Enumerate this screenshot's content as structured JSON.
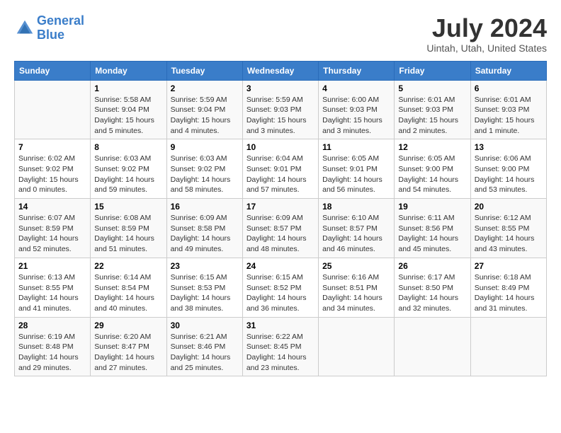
{
  "header": {
    "logo_line1": "General",
    "logo_line2": "Blue",
    "month_title": "July 2024",
    "location": "Uintah, Utah, United States"
  },
  "calendar": {
    "weekdays": [
      "Sunday",
      "Monday",
      "Tuesday",
      "Wednesday",
      "Thursday",
      "Friday",
      "Saturday"
    ],
    "weeks": [
      [
        {
          "day": "",
          "info": ""
        },
        {
          "day": "1",
          "info": "Sunrise: 5:58 AM\nSunset: 9:04 PM\nDaylight: 15 hours\nand 5 minutes."
        },
        {
          "day": "2",
          "info": "Sunrise: 5:59 AM\nSunset: 9:04 PM\nDaylight: 15 hours\nand 4 minutes."
        },
        {
          "day": "3",
          "info": "Sunrise: 5:59 AM\nSunset: 9:03 PM\nDaylight: 15 hours\nand 3 minutes."
        },
        {
          "day": "4",
          "info": "Sunrise: 6:00 AM\nSunset: 9:03 PM\nDaylight: 15 hours\nand 3 minutes."
        },
        {
          "day": "5",
          "info": "Sunrise: 6:01 AM\nSunset: 9:03 PM\nDaylight: 15 hours\nand 2 minutes."
        },
        {
          "day": "6",
          "info": "Sunrise: 6:01 AM\nSunset: 9:03 PM\nDaylight: 15 hours\nand 1 minute."
        }
      ],
      [
        {
          "day": "7",
          "info": "Sunrise: 6:02 AM\nSunset: 9:02 PM\nDaylight: 15 hours\nand 0 minutes."
        },
        {
          "day": "8",
          "info": "Sunrise: 6:03 AM\nSunset: 9:02 PM\nDaylight: 14 hours\nand 59 minutes."
        },
        {
          "day": "9",
          "info": "Sunrise: 6:03 AM\nSunset: 9:02 PM\nDaylight: 14 hours\nand 58 minutes."
        },
        {
          "day": "10",
          "info": "Sunrise: 6:04 AM\nSunset: 9:01 PM\nDaylight: 14 hours\nand 57 minutes."
        },
        {
          "day": "11",
          "info": "Sunrise: 6:05 AM\nSunset: 9:01 PM\nDaylight: 14 hours\nand 56 minutes."
        },
        {
          "day": "12",
          "info": "Sunrise: 6:05 AM\nSunset: 9:00 PM\nDaylight: 14 hours\nand 54 minutes."
        },
        {
          "day": "13",
          "info": "Sunrise: 6:06 AM\nSunset: 9:00 PM\nDaylight: 14 hours\nand 53 minutes."
        }
      ],
      [
        {
          "day": "14",
          "info": "Sunrise: 6:07 AM\nSunset: 8:59 PM\nDaylight: 14 hours\nand 52 minutes."
        },
        {
          "day": "15",
          "info": "Sunrise: 6:08 AM\nSunset: 8:59 PM\nDaylight: 14 hours\nand 51 minutes."
        },
        {
          "day": "16",
          "info": "Sunrise: 6:09 AM\nSunset: 8:58 PM\nDaylight: 14 hours\nand 49 minutes."
        },
        {
          "day": "17",
          "info": "Sunrise: 6:09 AM\nSunset: 8:57 PM\nDaylight: 14 hours\nand 48 minutes."
        },
        {
          "day": "18",
          "info": "Sunrise: 6:10 AM\nSunset: 8:57 PM\nDaylight: 14 hours\nand 46 minutes."
        },
        {
          "day": "19",
          "info": "Sunrise: 6:11 AM\nSunset: 8:56 PM\nDaylight: 14 hours\nand 45 minutes."
        },
        {
          "day": "20",
          "info": "Sunrise: 6:12 AM\nSunset: 8:55 PM\nDaylight: 14 hours\nand 43 minutes."
        }
      ],
      [
        {
          "day": "21",
          "info": "Sunrise: 6:13 AM\nSunset: 8:55 PM\nDaylight: 14 hours\nand 41 minutes."
        },
        {
          "day": "22",
          "info": "Sunrise: 6:14 AM\nSunset: 8:54 PM\nDaylight: 14 hours\nand 40 minutes."
        },
        {
          "day": "23",
          "info": "Sunrise: 6:15 AM\nSunset: 8:53 PM\nDaylight: 14 hours\nand 38 minutes."
        },
        {
          "day": "24",
          "info": "Sunrise: 6:15 AM\nSunset: 8:52 PM\nDaylight: 14 hours\nand 36 minutes."
        },
        {
          "day": "25",
          "info": "Sunrise: 6:16 AM\nSunset: 8:51 PM\nDaylight: 14 hours\nand 34 minutes."
        },
        {
          "day": "26",
          "info": "Sunrise: 6:17 AM\nSunset: 8:50 PM\nDaylight: 14 hours\nand 32 minutes."
        },
        {
          "day": "27",
          "info": "Sunrise: 6:18 AM\nSunset: 8:49 PM\nDaylight: 14 hours\nand 31 minutes."
        }
      ],
      [
        {
          "day": "28",
          "info": "Sunrise: 6:19 AM\nSunset: 8:48 PM\nDaylight: 14 hours\nand 29 minutes."
        },
        {
          "day": "29",
          "info": "Sunrise: 6:20 AM\nSunset: 8:47 PM\nDaylight: 14 hours\nand 27 minutes."
        },
        {
          "day": "30",
          "info": "Sunrise: 6:21 AM\nSunset: 8:46 PM\nDaylight: 14 hours\nand 25 minutes."
        },
        {
          "day": "31",
          "info": "Sunrise: 6:22 AM\nSunset: 8:45 PM\nDaylight: 14 hours\nand 23 minutes."
        },
        {
          "day": "",
          "info": ""
        },
        {
          "day": "",
          "info": ""
        },
        {
          "day": "",
          "info": ""
        }
      ]
    ]
  }
}
